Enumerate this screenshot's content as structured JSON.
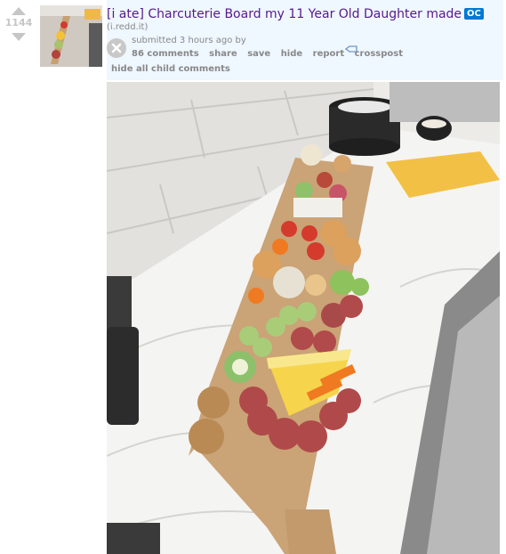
{
  "post": {
    "score": "1144",
    "title": "[i ate] Charcuterie Board my 11 Year Old Daughter made",
    "flair": "OC",
    "domain": "(i.redd.it)",
    "tagline_prefix": "submitted 3 hours ago by",
    "author": "",
    "buttons": {
      "comments": "86 comments",
      "share": "share",
      "save": "save",
      "hide": "hide",
      "report": "report",
      "crosspost": "crosspost"
    },
    "hide_children": "hide all child comments"
  },
  "colors": {
    "entry_bg": "#eff7ff",
    "title": "#551a8b",
    "flair_bg": "#0079d3",
    "muted": "#888888",
    "arrow": "#c6c6c6"
  },
  "icons": [
    "upvote-arrow-icon",
    "downvote-arrow-icon",
    "close-x-icon",
    "expando-link-icon"
  ]
}
